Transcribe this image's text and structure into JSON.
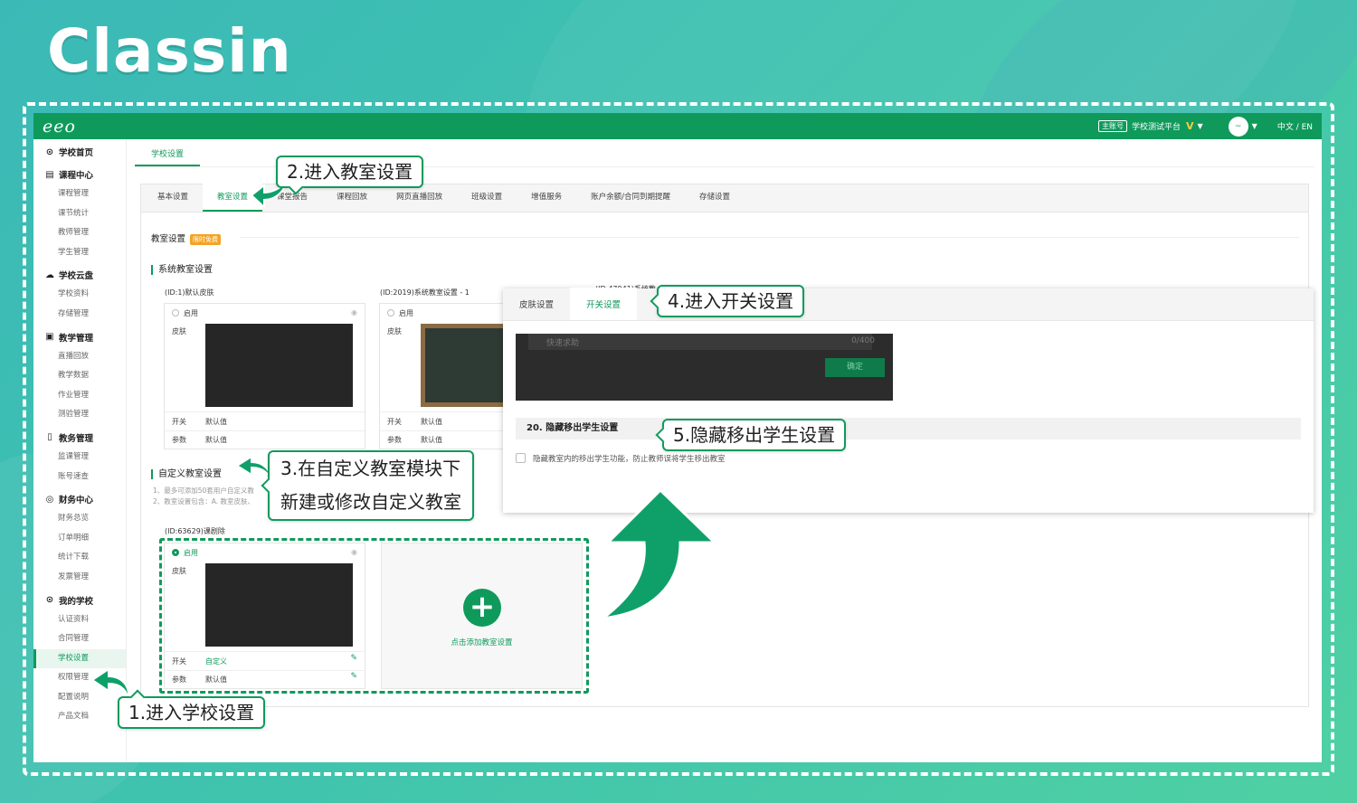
{
  "brand": "Classin",
  "topbar": {
    "logo": "eeo",
    "account_badge": "主账号",
    "school_name": "学校测试平台",
    "vip": "V",
    "avatar_text": "~",
    "language": "中文 / EN"
  },
  "sidebar": {
    "groups": [
      {
        "icon": "⊙",
        "label": "学校首页",
        "items": []
      },
      {
        "icon": "▤",
        "label": "课程中心",
        "items": [
          "课程管理",
          "课节统计",
          "教师管理",
          "学生管理"
        ]
      },
      {
        "icon": "☁",
        "label": "学校云盘",
        "items": [
          "学校资料",
          "存储管理"
        ]
      },
      {
        "icon": "▣",
        "label": "教学管理",
        "items": [
          "直播回放",
          "教学数据",
          "作业管理",
          "测验管理"
        ]
      },
      {
        "icon": "▯",
        "label": "教务管理",
        "items": [
          "监课管理",
          "账号速查"
        ]
      },
      {
        "icon": "◎",
        "label": "财务中心",
        "items": [
          "财务总览",
          "订单明细",
          "统计下载",
          "发票管理"
        ]
      },
      {
        "icon": "⊙",
        "label": "我的学校",
        "items": [
          "认证资料",
          "合同管理",
          "学校设置",
          "权限管理",
          "配置说明",
          "产品文档"
        ]
      }
    ],
    "active_item": "学校设置"
  },
  "main": {
    "page_tab": "学校设置",
    "sub_tabs": [
      "基本设置",
      "教室设置",
      "课堂报告",
      "课程回放",
      "网页直播回放",
      "班级设置",
      "增值服务",
      "账户余额/合同到期提醒",
      "存储设置"
    ],
    "active_sub_tab": "教室设置",
    "classroom_title": "教室设置",
    "free_badge": "限时免费",
    "system_title": "系统教室设置",
    "cards": [
      {
        "title": "(ID:1)默认皮肤",
        "enable": "启用",
        "skin": "皮肤",
        "switch_k": "开关",
        "switch_v": "默认值",
        "param_k": "参数",
        "param_v": "默认值"
      },
      {
        "title": "(ID:2019)系统教室设置 - 1",
        "enable": "启用",
        "skin": "皮肤",
        "switch_k": "开关",
        "switch_v": "默认值",
        "param_k": "参数",
        "param_v": "默认值"
      }
    ],
    "third_card_title": "(ID:47941)系统教",
    "custom_title": "自定义教室设置",
    "notes": [
      "1、最多可添加50套用户自定义教",
      "2、教室设置包含：A. 教室皮肤、"
    ],
    "custom_card": {
      "title": "(ID:63629)课剧除",
      "enable": "启用",
      "skin": "皮肤",
      "switch_k": "开关",
      "switch_v": "自定义",
      "param_k": "参数",
      "param_v": "默认值"
    },
    "add_card": {
      "plus": "+",
      "label": "点击添加教室设置"
    }
  },
  "popup": {
    "tabs": [
      "皮肤设置",
      "开关设置"
    ],
    "active_tab": "开关设置",
    "input_placeholder": "快速求助",
    "input_count": "0/400",
    "confirm": "确定",
    "section": "20. 隐藏移出学生设置",
    "checkbox_label": "隐藏教室内的移出学生功能，防止教师误将学生移出教室"
  },
  "callouts": {
    "step1": "1.进入学校设置",
    "step2": "2.进入教室设置",
    "step3_line1": "3.在自定义教室模块下",
    "step3_line2": "新建或修改自定义教室",
    "step4": "4.进入开关设置",
    "step5": "5.隐藏移出学生设置"
  },
  "colors": {
    "primary": "#0f9a5c",
    "badge": "#f3a424",
    "background": "#3fc3ae"
  }
}
